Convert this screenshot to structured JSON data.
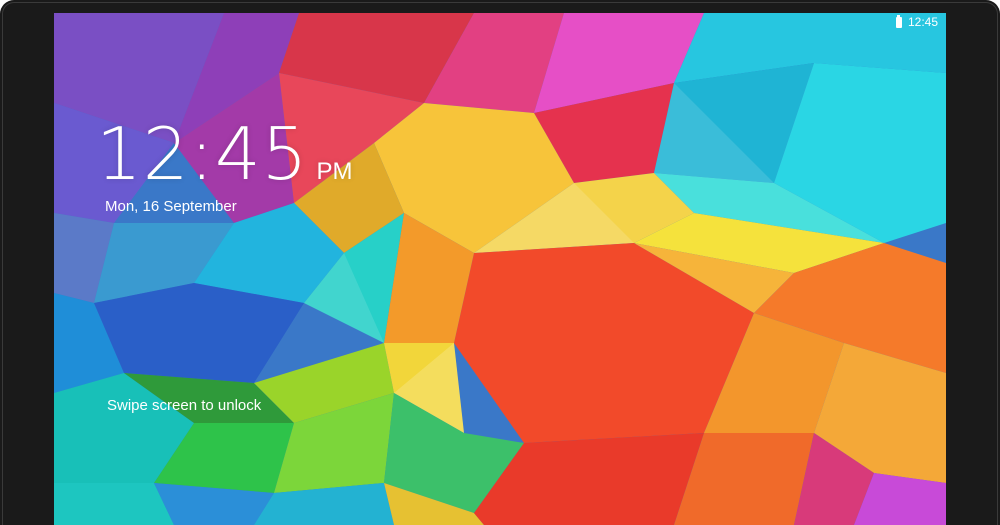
{
  "status_bar": {
    "time": "12:45",
    "battery_icon": "battery-full-icon"
  },
  "lock_screen": {
    "time": "12:45",
    "ampm": "PM",
    "date": "Mon, 16 September",
    "unlock_hint": "Swipe screen to unlock"
  },
  "colors": {
    "bezel": "#1a1a1a",
    "text": "#ffffff"
  }
}
